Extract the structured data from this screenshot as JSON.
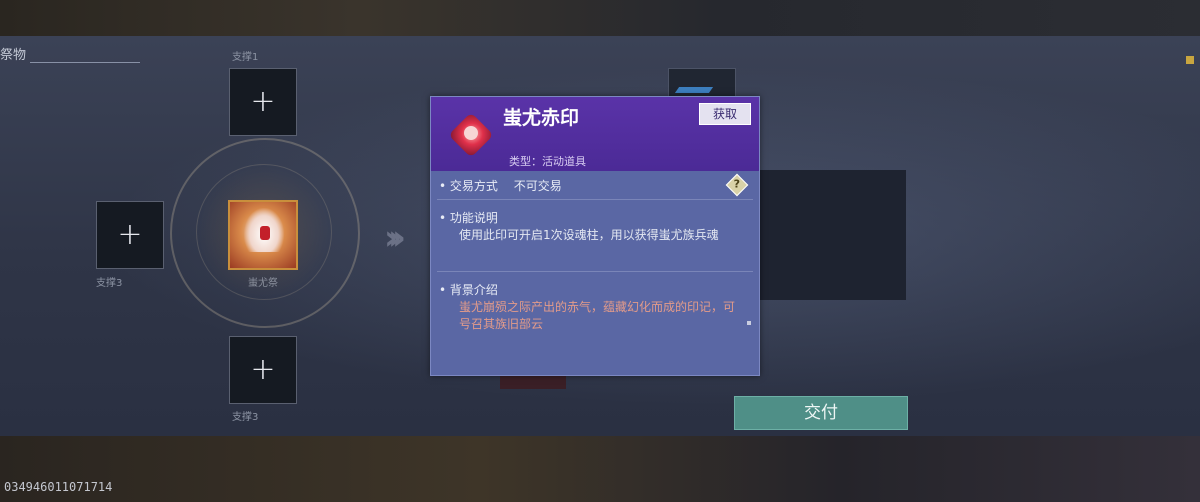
{
  "panel": {
    "title": "祭物"
  },
  "serial": "034946011071714",
  "ring": {
    "top_slot_label": "支撑1",
    "left_slot_label": "支撑3",
    "bottom_slot_label": "支撑3",
    "center_label": "蚩尤祭"
  },
  "slots": {
    "plus": "+"
  },
  "chevrons": "›››",
  "deliver_button": "交付",
  "tooltip": {
    "item_name": "蚩尤赤印",
    "obtain_button": "获取",
    "item_type": "类型：活动道具",
    "trade_label": "• 交易方式",
    "trade_value": "不可交易",
    "help_glyph": "?",
    "function_title": "• 功能说明",
    "function_text": "使用此印可开启1次设魂柱，用以获得蚩尤族兵魂",
    "background_title": "• 背景介绍",
    "background_text": "蚩尤崩殒之际产出的赤气，蕴藏幻化而成的印记，可号召其族旧部云"
  }
}
